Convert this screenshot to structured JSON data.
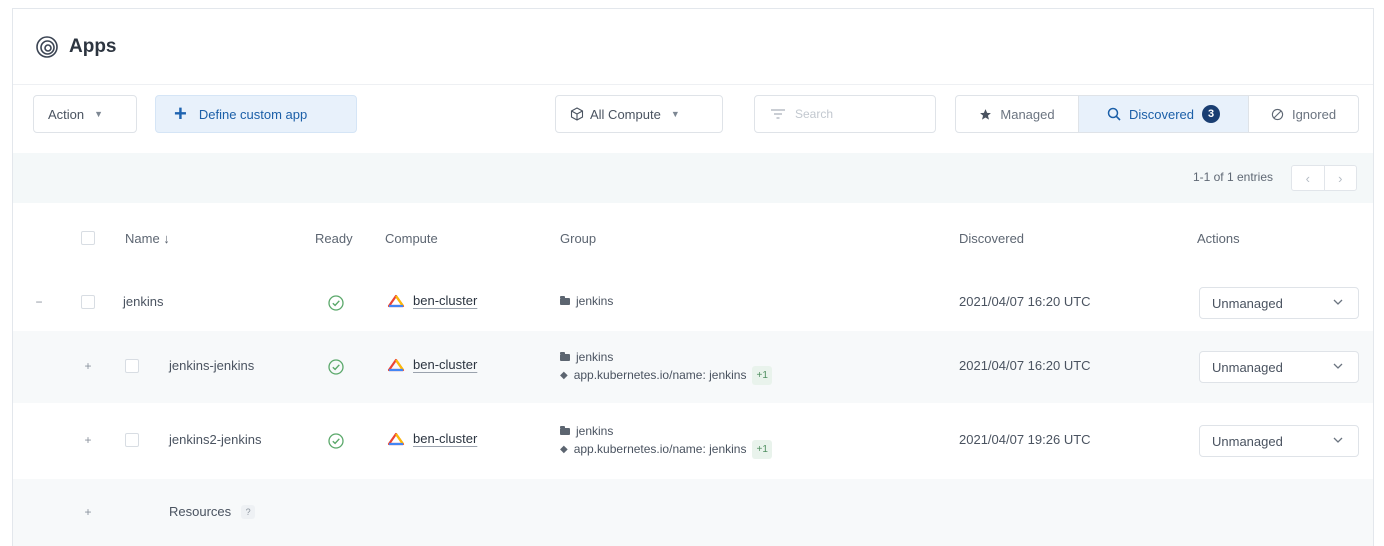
{
  "page": {
    "title": "Apps",
    "icon": "apps-swirl-icon"
  },
  "toolbar": {
    "action_label": "Action",
    "define_label": "Define custom app",
    "compute_label": "All Compute",
    "search_placeholder": "Search",
    "tabs": [
      {
        "label": "Managed",
        "icon": "star-icon"
      },
      {
        "label": "Discovered",
        "icon": "search-icon",
        "count": "3",
        "active": true
      },
      {
        "label": "Ignored",
        "icon": "ban-icon"
      }
    ]
  },
  "pagination": {
    "entries_text": "1-1 of 1 entries",
    "prev": "‹",
    "next": "›"
  },
  "table": {
    "headers": {
      "name": "Name ↓",
      "ready": "Ready",
      "compute": "Compute",
      "group": "Group",
      "discovered": "Discovered",
      "actions": "Actions"
    },
    "rows": [
      {
        "expander": "−",
        "name": "jenkins",
        "compute": "ben-cluster",
        "group_folder": "jenkins",
        "discovered": "2021/04/07 16:20 UTC",
        "action": "Unmanaged"
      },
      {
        "expander": "+",
        "name": "jenkins-jenkins",
        "compute": "ben-cluster",
        "group_folder": "jenkins",
        "group_label": "app.kubernetes.io/name: jenkins",
        "group_more": "+1",
        "discovered": "2021/04/07 16:20 UTC",
        "action": "Unmanaged"
      },
      {
        "expander": "+",
        "name": "jenkins2-jenkins",
        "compute": "ben-cluster",
        "group_folder": "jenkins",
        "group_label": "app.kubernetes.io/name: jenkins",
        "group_more": "+1",
        "discovered": "2021/04/07 19:26 UTC",
        "action": "Unmanaged"
      },
      {
        "expander": "+",
        "name": "Resources",
        "help": "?"
      }
    ]
  },
  "colors": {
    "accent": "#1b5fa8",
    "badge": "#1a3e72",
    "ready": "#5aa86a"
  }
}
